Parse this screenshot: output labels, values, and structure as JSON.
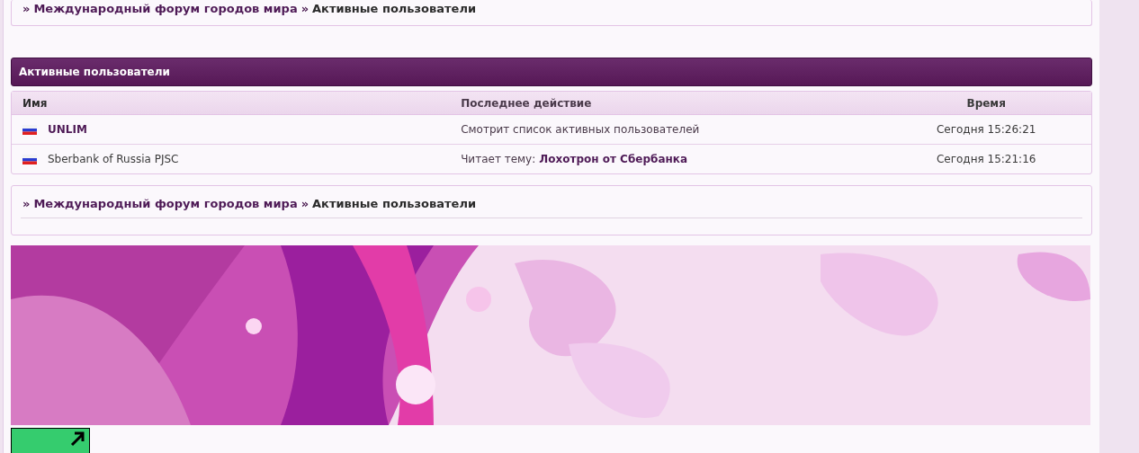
{
  "top_breadcrumb": [
    {
      "separator": "»",
      "label": "Международный форум городов мира",
      "kind": "link"
    },
    {
      "separator": "»",
      "label": "Активные пользователи",
      "kind": "current"
    }
  ],
  "panel": {
    "title": "Активные пользователи"
  },
  "table": {
    "columns": [
      "Имя",
      "Последнее действие",
      "Время"
    ],
    "rows": [
      {
        "name": "UNLIM",
        "highlighted": true,
        "action": "Смотрит список активных пользователей",
        "time": "Сегодня 15:26:21"
      },
      {
        "name": "Sberbank of Russia PJSC",
        "highlighted": false,
        "action": "Читает тему:",
        "topic": "Лохотрон от Сбербанка",
        "time": "Сегодня 15:21:16"
      }
    ]
  },
  "bottom_breadcrumb": [
    {
      "separator": "»",
      "label": "Международный форум городов мира",
      "kind": "link"
    },
    {
      "separator": "»",
      "label": "Активные пользователи",
      "kind": "current"
    }
  ]
}
